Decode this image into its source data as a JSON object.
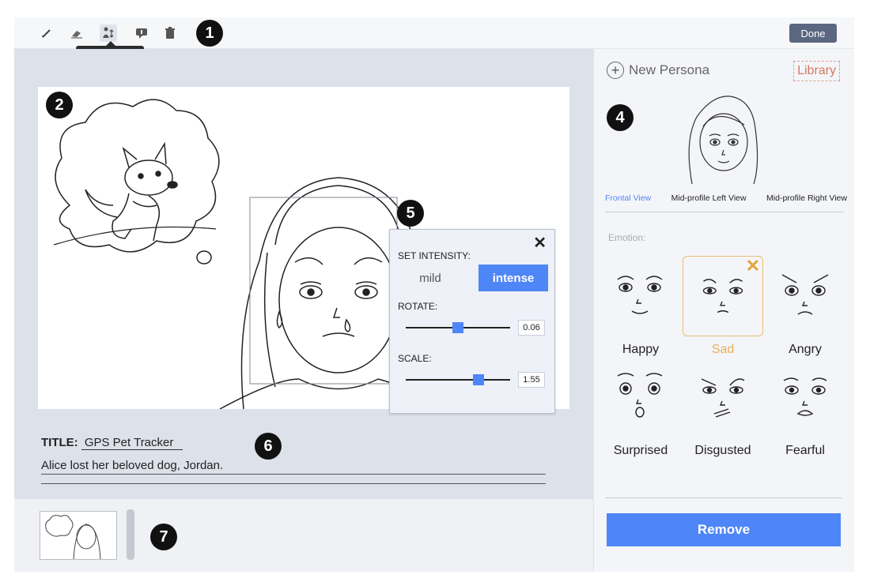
{
  "toolbar": {
    "tools": [
      {
        "icon": "pencil-icon"
      },
      {
        "icon": "eraser-icon"
      },
      {
        "icon": "move-icon"
      },
      {
        "icon": "speech-bubble-icon"
      },
      {
        "icon": "trash-icon"
      }
    ],
    "tooltip": "move",
    "done_label": "Done"
  },
  "badges": [
    "1",
    "2",
    "4",
    "5",
    "6",
    "7"
  ],
  "story": {
    "title_label": "TITLE:",
    "title_value": "GPS Pet Tracker",
    "text": "Alice lost her beloved dog, Jordan."
  },
  "adjust_panel": {
    "intensity_label": "SET INTENSITY:",
    "mild": "mild",
    "intense": "intense",
    "selected_intensity": "intense",
    "rotate_label": "ROTATE:",
    "rotate_value": "0.06",
    "scale_label": "SCALE:",
    "scale_value": "1.55",
    "close_icon": "close-icon"
  },
  "persona": {
    "new_label": "New Persona",
    "library_label": "Library",
    "views": [
      "Frontal View",
      "Mid-profile Left View",
      "Mid-profile Right View"
    ],
    "selected_view": "Frontal View",
    "emotion_heading": "Emotion:",
    "emotions": [
      "Happy",
      "Sad",
      "Angry",
      "Surprised",
      "Disgusted",
      "Fearful"
    ],
    "selected_emotion": "Sad",
    "remove_label": "Remove"
  },
  "colors": {
    "accent": "#4f86f7",
    "selected_emotion": "#e6b05c",
    "library": "#d27a62",
    "done": "#5b6781"
  }
}
